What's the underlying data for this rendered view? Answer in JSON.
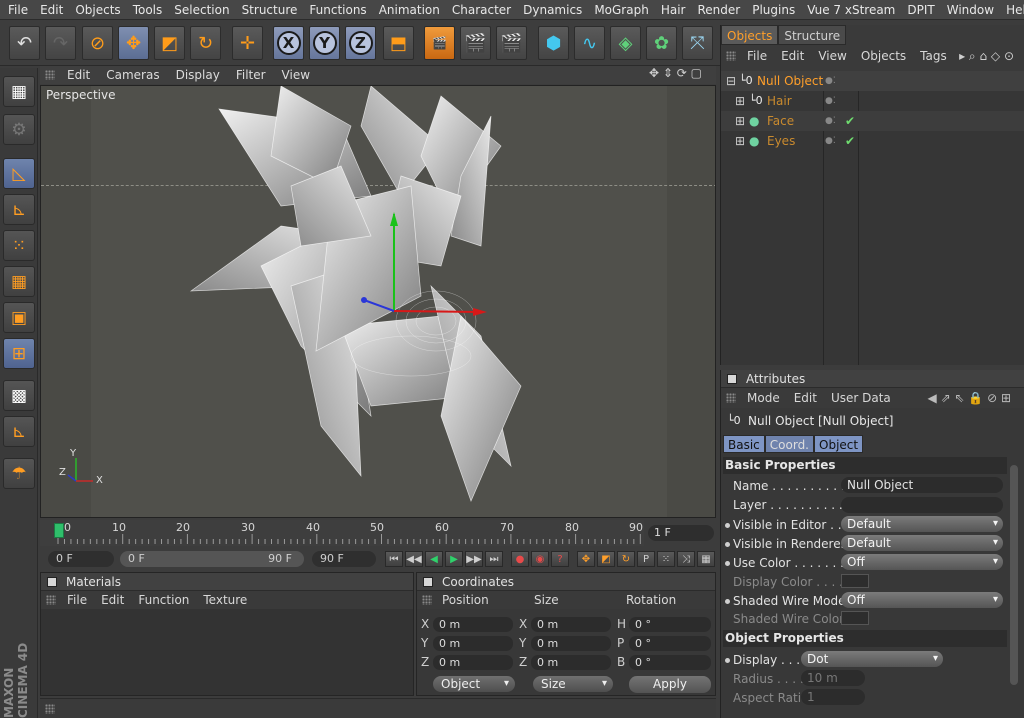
{
  "menu": [
    "File",
    "Edit",
    "Objects",
    "Tools",
    "Selection",
    "Structure",
    "Functions",
    "Animation",
    "Character",
    "Dynamics",
    "MoGraph",
    "Hair",
    "Render",
    "Plugins",
    "Vue 7 xStream",
    "DPIT",
    "Window",
    "Help"
  ],
  "viewport": {
    "menu": [
      "Edit",
      "Cameras",
      "Display",
      "Filter",
      "View"
    ],
    "label": "Perspective",
    "axis_y": "Y",
    "axis_z": "Z",
    "axis_x": "X"
  },
  "timeline": {
    "ticks": [
      "0",
      "10",
      "20",
      "30",
      "40",
      "50",
      "60",
      "70",
      "80",
      "90"
    ],
    "current_frame": "1 F",
    "start_field": "0 F",
    "range_start": "0 F",
    "range_end": "90 F",
    "end_field": "90 F"
  },
  "materials": {
    "title": "Materials",
    "menu": [
      "File",
      "Edit",
      "Function",
      "Texture"
    ]
  },
  "coordinates": {
    "title": "Coordinates",
    "col_position": "Position",
    "col_size": "Size",
    "col_rotation": "Rotation",
    "rows": [
      {
        "axis": "X",
        "pos": "0 m",
        "size_axis": "X",
        "size": "0 m",
        "rot_axis": "H",
        "rot": "0 °"
      },
      {
        "axis": "Y",
        "pos": "0 m",
        "size_axis": "Y",
        "size": "0 m",
        "rot_axis": "P",
        "rot": "0 °"
      },
      {
        "axis": "Z",
        "pos": "0 m",
        "size_axis": "Z",
        "size": "0 m",
        "rot_axis": "B",
        "rot": "0 °"
      }
    ],
    "mode_select": "Object",
    "size_select": "Size",
    "apply": "Apply"
  },
  "objects": {
    "tabs": [
      "Objects",
      "Structure"
    ],
    "menu": [
      "File",
      "Edit",
      "View",
      "Objects",
      "Tags"
    ],
    "items": [
      {
        "name": "Null Object",
        "color": "#ff9f2a"
      },
      {
        "name": "Hair",
        "color": "#c98a2e"
      },
      {
        "name": "Face",
        "color": "#c98a2e"
      },
      {
        "name": "Eyes",
        "color": "#c98a2e"
      }
    ]
  },
  "attributes": {
    "title": "Attributes",
    "menu": [
      "Mode",
      "Edit",
      "User Data"
    ],
    "object_title": "Null Object [Null Object]",
    "tabs": [
      "Basic",
      "Coord.",
      "Object"
    ],
    "basic_heading": "Basic Properties",
    "basic": [
      {
        "label": "Name . . . . . . . . . . . .",
        "value": "Null Object"
      },
      {
        "label": "Layer . . . . . . . . . . . .",
        "value": ""
      },
      {
        "label": "Visible in Editor . . . . .",
        "value": "Default"
      },
      {
        "label": "Visible in Renderer . .",
        "value": "Default"
      },
      {
        "label": "Use Color . . . . . . . . .",
        "value": "Off"
      },
      {
        "label": "Display Color . . . .",
        "value": ""
      },
      {
        "label": "Shaded Wire Mode",
        "value": "Off"
      },
      {
        "label": "Shaded Wire Color",
        "value": ""
      }
    ],
    "object_heading": "Object Properties",
    "object_props": [
      {
        "label": "Display . . . .",
        "value": "Dot"
      },
      {
        "label": "Radius . . . .",
        "value": "10 m"
      },
      {
        "label": "Aspect Ratio",
        "value": "1"
      }
    ]
  },
  "brand": "MAXON CINEMA 4D",
  "colors": {
    "accent": "#ff9f2a",
    "selection_blue": "#6a7fa8"
  }
}
